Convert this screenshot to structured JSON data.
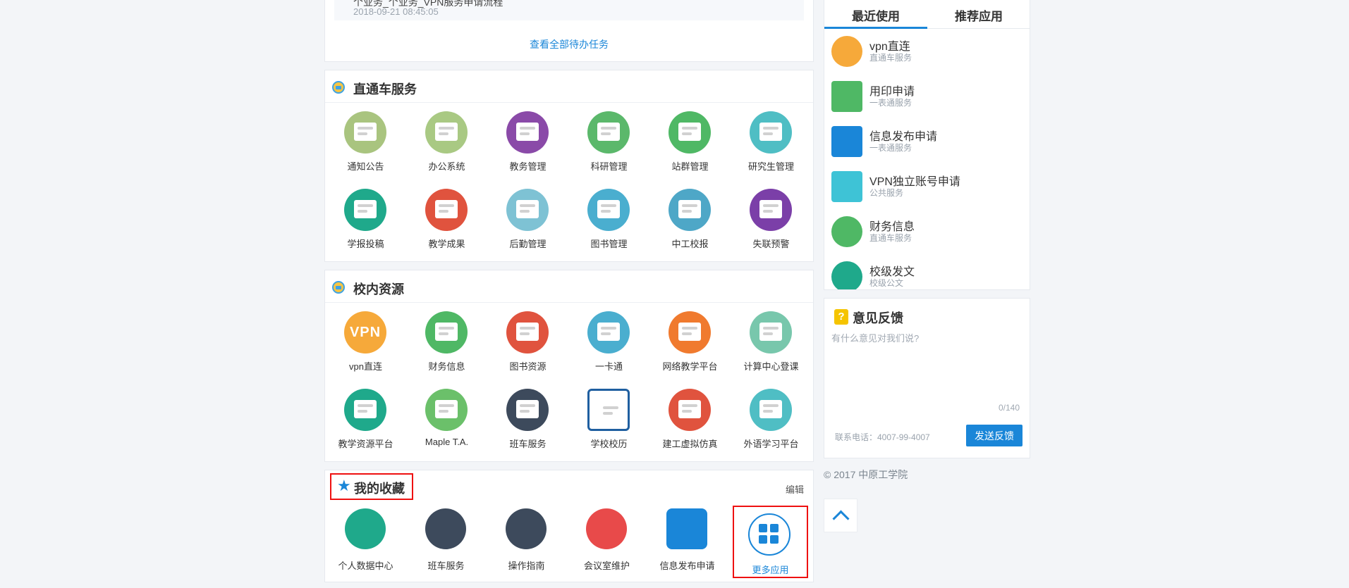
{
  "tasks": {
    "item": {
      "title": "个业务_个业务_VPN服务申请流程",
      "time": "2018-09-21 08:45:05"
    },
    "view_all": "查看全部待办任务"
  },
  "direct_service": {
    "title": "直通车服务",
    "apps": [
      {
        "label": "通知公告",
        "color": "#a9c47f"
      },
      {
        "label": "办公系统",
        "color": "#a9c983"
      },
      {
        "label": "教务管理",
        "color": "#8a4aa8"
      },
      {
        "label": "科研管理",
        "color": "#5bb86b"
      },
      {
        "label": "站群管理",
        "color": "#4fb865"
      },
      {
        "label": "研究生管理",
        "color": "#4fbec4"
      },
      {
        "label": "学报投稿",
        "color": "#1fa98b"
      },
      {
        "label": "教学成果",
        "color": "#e0533e"
      },
      {
        "label": "后勤管理",
        "color": "#7ec2d4"
      },
      {
        "label": "图书管理",
        "color": "#4aaecf"
      },
      {
        "label": "中工校报",
        "color": "#4ea7c7"
      },
      {
        "label": "失联预警",
        "color": "#7b3fa8"
      }
    ]
  },
  "campus_resources": {
    "title": "校内资源",
    "apps": [
      {
        "label": "vpn直连",
        "color": "#f6a93a",
        "text": "VPN"
      },
      {
        "label": "财务信息",
        "color": "#4fb865"
      },
      {
        "label": "图书资源",
        "color": "#e0533e"
      },
      {
        "label": "一卡通",
        "color": "#4aaecf"
      },
      {
        "label": "网络教学平台",
        "color": "#f07a2e"
      },
      {
        "label": "计算中心登课",
        "color": "#78c7ac"
      },
      {
        "label": "教学资源平台",
        "color": "#1fa98b"
      },
      {
        "label": "Maple T.A.",
        "color": "#6bc06a"
      },
      {
        "label": "班车服务",
        "color": "#3d4a5c"
      },
      {
        "label": "学校校历",
        "color": "#ffffff"
      },
      {
        "label": "建工虚拟仿真",
        "color": "#e0533e"
      },
      {
        "label": "外语学习平台",
        "color": "#4fbec4"
      }
    ]
  },
  "favorites": {
    "title": "我的收藏",
    "edit": "编辑",
    "items": [
      {
        "label": "个人数据中心",
        "color": "#1fa98b"
      },
      {
        "label": "班车服务",
        "color": "#3d4a5c"
      },
      {
        "label": "操作指南",
        "color": "#3d4a5c"
      },
      {
        "label": "会议室维护",
        "color": "#e84a4a"
      },
      {
        "label": "信息发布申请",
        "color": "#1a86d8"
      }
    ],
    "more": "更多应用"
  },
  "recent": {
    "tabs": [
      "最近使用",
      "推荐应用"
    ],
    "items": [
      {
        "title": "vpn直连",
        "sub": "直通车服务",
        "color": "#f6a93a"
      },
      {
        "title": "用印申请",
        "sub": "一表通服务",
        "color": "#4fb865"
      },
      {
        "title": "信息发布申请",
        "sub": "一表通服务",
        "color": "#1a86d8"
      },
      {
        "title": "VPN独立账号申请",
        "sub": "公共服务",
        "color": "#3ec3d6"
      },
      {
        "title": "财务信息",
        "sub": "直通车服务",
        "color": "#4fb865"
      },
      {
        "title": "校级发文",
        "sub": "校级公文",
        "color": "#1fa98b"
      }
    ]
  },
  "feedback": {
    "title": "意见反馈",
    "icon": "?",
    "placeholder": "有什么意见对我们说?",
    "count": "0/140",
    "phone": "联系电话：4007-99-4007",
    "send": "发送反馈"
  },
  "footer": {
    "copyright": "© 2017 中原工学院"
  }
}
